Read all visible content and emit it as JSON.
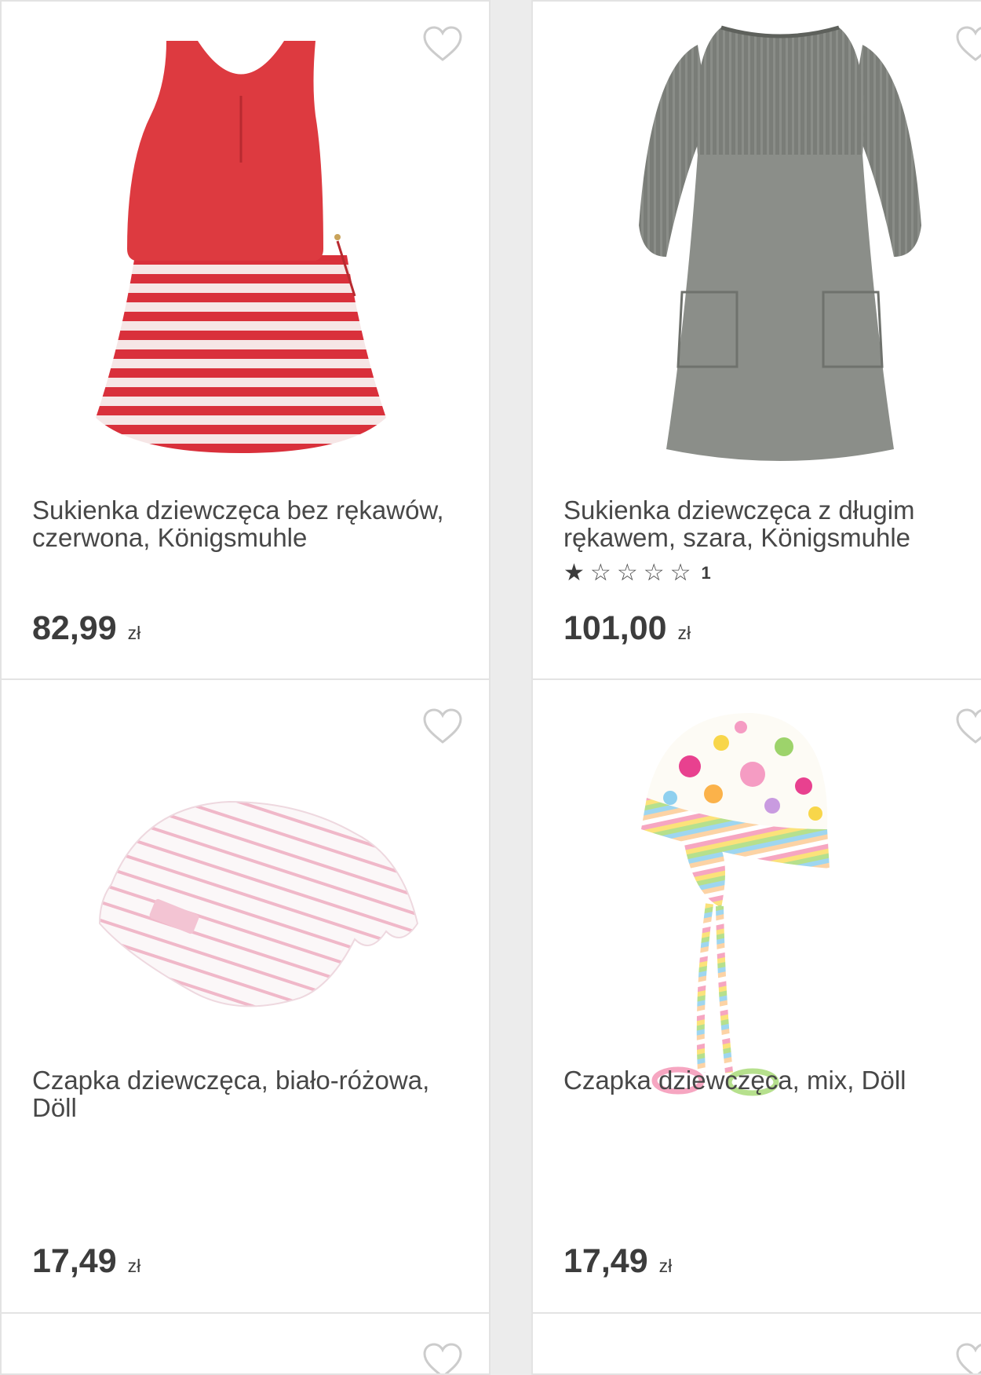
{
  "products": [
    {
      "name": "Sukienka dziewczęca bez rękawów, czerwona, Königsmuhle",
      "price": "82,99",
      "currency": "zł",
      "image": "red-striped-dress-image"
    },
    {
      "name": "Sukienka dziewczęca z długim rękawem, szara, Königsmuhle",
      "rating": 1,
      "rating_max": 5,
      "rating_count": "1",
      "price": "101,00",
      "currency": "zł",
      "image": "grey-knit-dress-image"
    },
    {
      "name": "Czapka dziewczęca, biało-różowa, Döll",
      "price": "17,49",
      "currency": "zł",
      "image": "white-pink-hat-image"
    },
    {
      "name": "Czapka dziewczęca, mix, Döll",
      "price": "17,49",
      "currency": "zł",
      "image": "polka-dot-hat-image"
    }
  ],
  "colors": {
    "text": "#474747",
    "price": "#3c3c3c",
    "card_border": "#e3e3e3",
    "heart_outline": "#cccccc",
    "background": "#ececec"
  },
  "icons": {
    "wishlist": "heart-outline-icon",
    "star_filled": "star-filled-icon",
    "star_empty": "star-outline-icon"
  }
}
